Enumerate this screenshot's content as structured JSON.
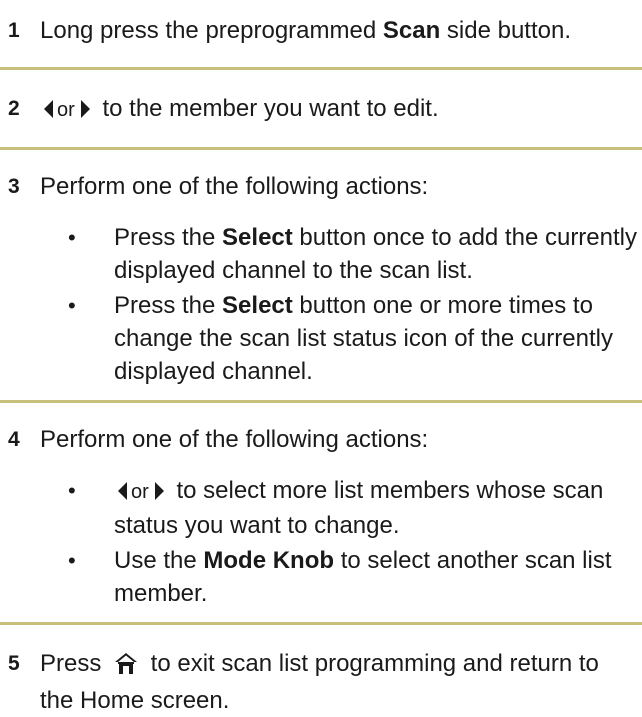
{
  "steps": [
    {
      "number": "1",
      "text_before": "Long press the preprogrammed ",
      "bold": "Scan",
      "text_after": " side button."
    },
    {
      "number": "2",
      "or_text": "or",
      "text_after": " to the member you want to edit."
    },
    {
      "number": "3",
      "text": "Perform one of the following actions:",
      "bullets": [
        {
          "before": "Press the ",
          "bold": "Select",
          "after": " button once to add the currently displayed channel to the scan list."
        },
        {
          "before": "Press the ",
          "bold": "Select",
          "after": " button one or more times to change the scan list status icon of the currently displayed channel."
        }
      ]
    },
    {
      "number": "4",
      "text": "Perform one of the following actions:",
      "bullets": [
        {
          "or_text": "or",
          "after": " to select more list members whose scan status you want to change."
        },
        {
          "before": "Use the ",
          "bold": "Mode Knob",
          "after": " to select another scan list member."
        }
      ]
    },
    {
      "number": "5",
      "text_before": "Press ",
      "text_after": " to exit scan list programming and return to the Home screen."
    }
  ],
  "bullet_char": "•",
  "colors": {
    "rule": "#c8c07a",
    "text": "#1a1a1a"
  },
  "icons": {
    "left": "arrow-left-icon",
    "right": "arrow-right-icon",
    "home": "home-icon"
  }
}
